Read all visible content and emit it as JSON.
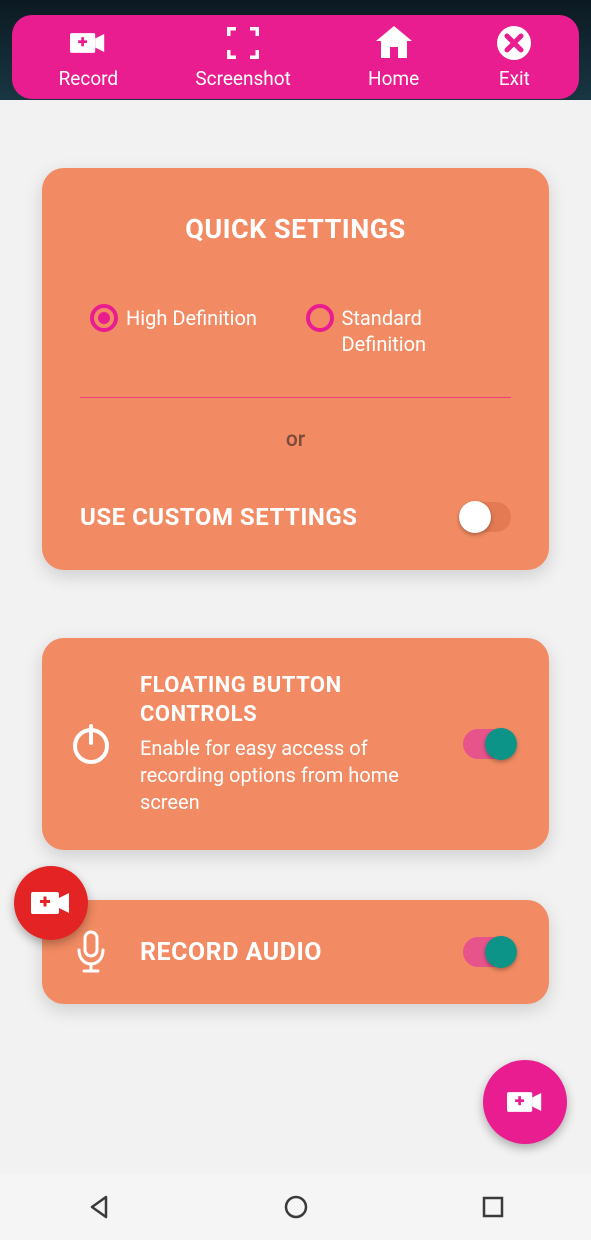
{
  "topbar": {
    "record": "Record",
    "screenshot": "Screenshot",
    "home": "Home",
    "exit": "Exit"
  },
  "quick": {
    "title": "QUICK SETTINGS",
    "hd": "High Definition",
    "sd": "Standard Definition",
    "or": "or",
    "custom": "USE CUSTOM SETTINGS",
    "custom_on": false
  },
  "floating": {
    "title": "FLOATING BUTTON CONTROLS",
    "desc": "Enable for easy access of recording options from home screen",
    "on": true
  },
  "audio": {
    "title": "RECORD AUDIO",
    "on": true
  },
  "colors": {
    "brand": "#e91d8f",
    "card": "#f28b63",
    "toggle_on": "#0d9488",
    "fab_red": "#e42424"
  }
}
